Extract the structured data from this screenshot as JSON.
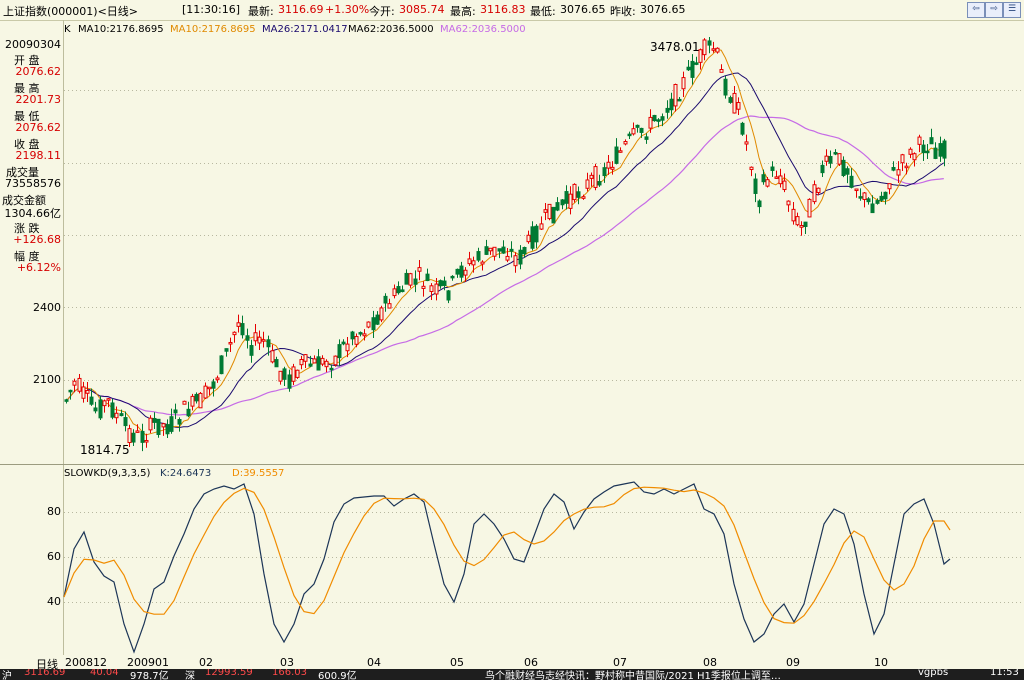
{
  "header": {
    "index_name": "上证指数(000001)<日线>",
    "time": "[11:30:16]",
    "latest_label": "最新:",
    "latest": "3116.69",
    "change": "+1.30%",
    "open_label": "今开:",
    "open": "3085.74",
    "high_label": "最高:",
    "high": "3116.83",
    "low_label": "最低:",
    "low": "3076.65",
    "prev_label": "昨收:",
    "prev": "3076.65"
  },
  "legend": {
    "k": "K",
    "ma10": "MA10:2176.8695",
    "ma10b": "MA10:2176.8695",
    "ma26": "MA26:2171.0417",
    "ma62": "MA62:2036.5000",
    "ma62b": "MA62:2036.5000"
  },
  "info_panel": {
    "date": "20090304",
    "open_label": "开 盘",
    "open": "2076.62",
    "high_label": "最 高",
    "high": "2201.73",
    "low_label": "最 低",
    "low": "2076.62",
    "close_label": "收 盘",
    "close": "2198.11",
    "volume_label": "成交量",
    "volume": "73558576",
    "amount_label": "成交金额",
    "amount": "1304.66亿",
    "change_label": "涨 跌",
    "change": "+126.68",
    "range_label": "幅 度",
    "range": "+6.12%"
  },
  "price_axis": [
    "2400",
    "2100"
  ],
  "annotations": {
    "high": "3478.01",
    "low": "1814.75"
  },
  "indicator": {
    "name": "SLOWKD(9,3,3,5)",
    "k": "K:24.6473",
    "d": "D:39.5557",
    "ticks": [
      "80",
      "60",
      "40"
    ]
  },
  "x_axis": {
    "label": "日线",
    "ticks": [
      "200812",
      "200901",
      "02",
      "03",
      "04",
      "05",
      "06",
      "07",
      "08",
      "09",
      "10"
    ]
  },
  "statusbar": {
    "items": [
      "沪",
      "3116.69",
      "40.04",
      "978.7亿",
      "深",
      "12993.59",
      "166.03",
      "600.9亿",
      "鸟个融财经鸟志经快讯：野村称中昔国际/2021 H1季报位上调至…",
      "vgpbs",
      "11:53"
    ]
  },
  "colors": {
    "up": "#e60000",
    "down": "#007a33",
    "ma10": "#e08a00",
    "ma26": "#1a0a6e",
    "ma62": "#c66be6",
    "k_line": "#1c3557",
    "d_line": "#f08c00"
  }
}
